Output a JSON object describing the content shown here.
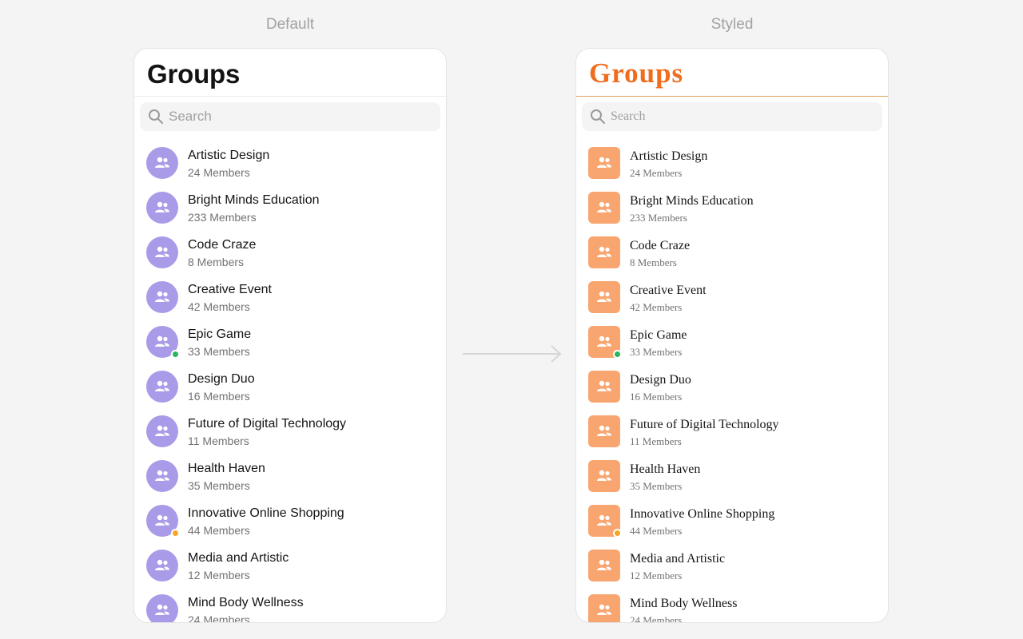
{
  "captions": {
    "default": "Default",
    "styled": "Styled"
  },
  "screen": {
    "title": "Groups",
    "search_placeholder": "Search"
  },
  "groups": [
    {
      "name": "Artistic Design",
      "members": "24 Members",
      "status": ""
    },
    {
      "name": "Bright Minds Education",
      "members": "233 Members",
      "status": ""
    },
    {
      "name": "Code Craze",
      "members": "8 Members",
      "status": ""
    },
    {
      "name": "Creative Event",
      "members": "42 Members",
      "status": ""
    },
    {
      "name": "Epic Game",
      "members": "33 Members",
      "status": "online"
    },
    {
      "name": "Design Duo",
      "members": "16 Members",
      "status": ""
    },
    {
      "name": "Future of Digital Technology",
      "members": "11 Members",
      "status": ""
    },
    {
      "name": "Health Haven",
      "members": "35 Members",
      "status": ""
    },
    {
      "name": "Innovative Online Shopping",
      "members": "44 Members",
      "status": "away"
    },
    {
      "name": "Media and Artistic",
      "members": "12 Members",
      "status": ""
    },
    {
      "name": "Mind Body Wellness",
      "members": "24 Members",
      "status": ""
    }
  ],
  "icons": {
    "search": "search-icon",
    "group": "group-icon",
    "arrow": "arrow-right-icon"
  },
  "colors": {
    "default_avatar": "#a99be8",
    "styled_avatar": "#f9a56f",
    "styled_title": "#f06d1e",
    "styled_divider": "#e0a05a",
    "online": "#27b65c",
    "away": "#f5a623"
  }
}
